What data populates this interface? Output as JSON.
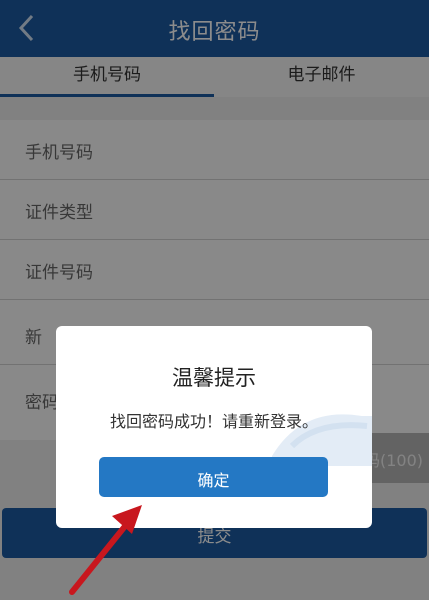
{
  "header": {
    "title": "找回密码",
    "back_icon": "chevron-left-icon"
  },
  "tabs": [
    {
      "label": "手机号码",
      "active": true
    },
    {
      "label": "电子邮件",
      "active": false
    }
  ],
  "form": {
    "fields": [
      {
        "label": "手机号码"
      },
      {
        "label": "证件类型"
      },
      {
        "label": "证件号码"
      },
      {
        "label": "新"
      },
      {
        "label": "密码"
      }
    ],
    "side_text": "码(100)",
    "submit_label": "提交"
  },
  "dialog": {
    "title": "温馨提示",
    "message": "找回密码成功！请重新登录。",
    "confirm_label": "确定"
  },
  "colors": {
    "header": "#1d5aa0",
    "button": "#2478c4",
    "arrow": "#c8171e"
  }
}
